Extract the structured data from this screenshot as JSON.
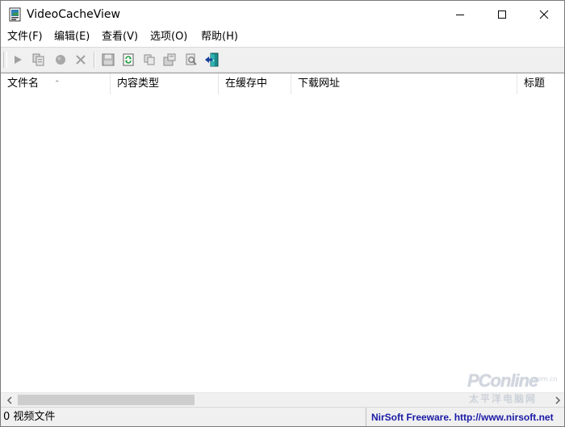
{
  "window": {
    "title": "VideoCacheView"
  },
  "menu": [
    {
      "label": "文件(F)"
    },
    {
      "label": "编辑(E)"
    },
    {
      "label": "查看(V)"
    },
    {
      "label": "选项(O)"
    },
    {
      "label": "帮助(H)"
    }
  ],
  "toolbar": [
    {
      "icon": "play-icon"
    },
    {
      "icon": "copy-files-icon"
    },
    {
      "icon": "record-icon"
    },
    {
      "icon": "delete-icon"
    },
    {
      "icon": "save-icon"
    },
    {
      "icon": "refresh-icon"
    },
    {
      "icon": "copy-icon"
    },
    {
      "icon": "properties-icon"
    },
    {
      "icon": "find-icon"
    },
    {
      "icon": "exit-icon"
    }
  ],
  "list": {
    "columns": [
      {
        "label": "文件名",
        "sorted": true
      },
      {
        "label": "内容类型"
      },
      {
        "label": "在缓存中"
      },
      {
        "label": "下载网址"
      },
      {
        "label": "标题"
      }
    ],
    "rows": []
  },
  "status": {
    "count_text": "0 视频文件",
    "link_text": "NirSoft Freeware.  http://www.nirsoft.net"
  },
  "watermark": {
    "logo": "PConline",
    "sub": "太平洋电脑网",
    "com": ".com.cn"
  },
  "colors": {
    "status_link": "#1a1aa6",
    "toolbar_bg": "#f0f0f0"
  }
}
